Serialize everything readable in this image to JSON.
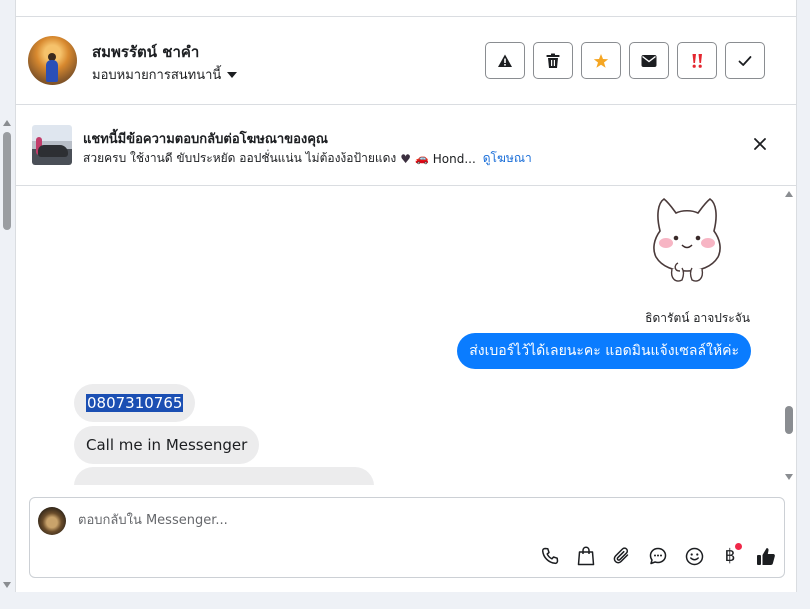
{
  "header": {
    "contact_name": "สมพรรัตน์ ชาคำ",
    "assign_label": "มอบหมายการสนทนานี้",
    "actions": [
      {
        "name": "report-spam-button",
        "icon": "warning-icon"
      },
      {
        "name": "delete-button",
        "icon": "trash-icon"
      },
      {
        "name": "star-button",
        "icon": "star-icon"
      },
      {
        "name": "mark-unread-button",
        "icon": "envelope-icon"
      },
      {
        "name": "follow-up-button",
        "icon": "urgent-icon"
      },
      {
        "name": "mark-done-button",
        "icon": "check-icon"
      }
    ]
  },
  "ad_banner": {
    "title": "แชทนี้มีข้อความตอบกลับต่อโฆษณาของคุณ",
    "subtitle": "สวยครบ ใช้งานดี ขับประหยัด ออปชั่นแน่น ไม่ต้องง้อป้ายแดง",
    "subtitle_tail": "Hond...",
    "link_label": "ดูโฆษณา"
  },
  "chat": {
    "sender_name": "ธิดารัตน์ อาจประจัน",
    "outgoing_message": "ส่งเบอร์ไว้ได้เลยนะคะ แอดมินแจ้งเซลล์ให้ค่ะ",
    "incoming": [
      {
        "text": "0807310765",
        "selected": true
      },
      {
        "text": "Call me in Messenger"
      }
    ]
  },
  "composer": {
    "placeholder": "ตอบกลับใน Messenger...",
    "tools": [
      {
        "name": "call-icon"
      },
      {
        "name": "shopping-bag-icon"
      },
      {
        "name": "paperclip-icon"
      },
      {
        "name": "chat-bubble-icon"
      },
      {
        "name": "emoji-icon"
      },
      {
        "name": "baht-payment-icon"
      },
      {
        "name": "thumbs-up-icon"
      }
    ]
  },
  "colors": {
    "accent": "#0a7cff",
    "link": "#1a6ed8",
    "star": "#f5a623",
    "urgent": "#e4262f",
    "selection": "#1b4fb3"
  }
}
